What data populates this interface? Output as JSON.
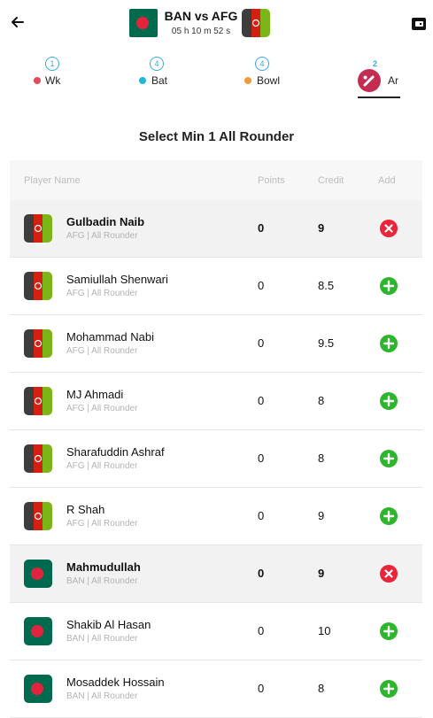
{
  "header": {
    "match_title": "BAN vs AFG",
    "timer": "05 h 10 m 52 s",
    "back_icon": "back-arrow-icon",
    "wallet_icon": "wallet-icon"
  },
  "colors": {
    "ban_green": "#006a4e",
    "ban_red": "#e0243e",
    "afg_black": "#3d3d3d",
    "afg_red": "#d32011",
    "afg_green": "#7cb518",
    "accent_blue": "#3ba8d8",
    "add_green": "#2db52d",
    "remove_red": "#e9243b"
  },
  "tabs": [
    {
      "count": "1",
      "label": "Wk",
      "dot_color": "#e14d57"
    },
    {
      "count": "4",
      "label": "Bat",
      "dot_color": "#1fb8d8"
    },
    {
      "count": "4",
      "label": "Bowl",
      "dot_color": "#f2993a"
    },
    {
      "count": "2",
      "label": "Ar",
      "icon": "cricket-bat-icon"
    }
  ],
  "section_title": "Select Min 1 All Rounder",
  "table_headers": {
    "name": "Player Name",
    "points": "Points",
    "credit": "Credit",
    "add": "Add"
  },
  "players": [
    {
      "name": "Gulbadin Naib",
      "meta": "AFG | All Rounder",
      "points": "0",
      "credit": "9",
      "team": "AFG",
      "selected": true
    },
    {
      "name": "Samiullah Shenwari",
      "meta": "AFG | All Rounder",
      "points": "0",
      "credit": "8.5",
      "team": "AFG",
      "selected": false
    },
    {
      "name": "Mohammad Nabi",
      "meta": "AFG | All Rounder",
      "points": "0",
      "credit": "9.5",
      "team": "AFG",
      "selected": false
    },
    {
      "name": "MJ Ahmadi",
      "meta": "AFG | All Rounder",
      "points": "0",
      "credit": "8",
      "team": "AFG",
      "selected": false
    },
    {
      "name": "Sharafuddin Ashraf",
      "meta": "AFG | All Rounder",
      "points": "0",
      "credit": "8",
      "team": "AFG",
      "selected": false
    },
    {
      "name": "R Shah",
      "meta": "AFG | All Rounder",
      "points": "0",
      "credit": "9",
      "team": "AFG",
      "selected": false
    },
    {
      "name": "Mahmudullah",
      "meta": "BAN | All Rounder",
      "points": "0",
      "credit": "9",
      "team": "BAN",
      "selected": true
    },
    {
      "name": "Shakib Al Hasan",
      "meta": "BAN | All Rounder",
      "points": "0",
      "credit": "10",
      "team": "BAN",
      "selected": false
    },
    {
      "name": "Mosaddek Hossain",
      "meta": "BAN | All Rounder",
      "points": "0",
      "credit": "8",
      "team": "BAN",
      "selected": false
    }
  ]
}
